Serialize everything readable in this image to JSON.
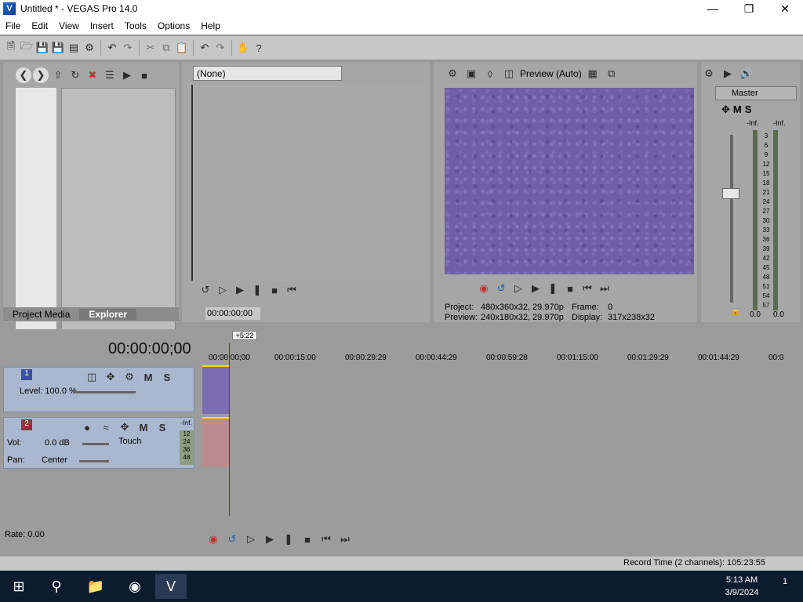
{
  "window": {
    "title": "Untitled * - VEGAS Pro 14.0"
  },
  "menu": [
    "File",
    "Edit",
    "View",
    "Insert",
    "Tools",
    "Options",
    "Help"
  ],
  "explorer": {
    "tabs": [
      "Project Media",
      "Explorer"
    ],
    "active_tab": "Explorer"
  },
  "trimmer": {
    "selected": "(None)",
    "timecode": "00:00:00;00"
  },
  "preview": {
    "quality": "Preview (Auto)",
    "project_label": "Project:",
    "project_value": "480x360x32, 29.970p",
    "preview_label": "Preview:",
    "preview_value": "240x180x32, 29.970p",
    "frame_label": "Frame:",
    "frame_value": "0",
    "display_label": "Display:",
    "display_value": "317x238x32"
  },
  "mixer": {
    "title": "Master",
    "inf_left": "-Inf.",
    "inf_right": "-Inf.",
    "scale": [
      "3",
      "6",
      "9",
      "12",
      "15",
      "18",
      "21",
      "24",
      "27",
      "30",
      "33",
      "36",
      "39",
      "42",
      "45",
      "48",
      "51",
      "54",
      "57"
    ],
    "foot_left": "0.0",
    "foot_right": "0.0"
  },
  "timeline": {
    "timecode": "00:00:00;00",
    "marker": "+5:22",
    "ruler": [
      "00:00:00;00",
      "00:00:15:00",
      "00:00:29:29",
      "00:00:44:29",
      "00:00:59:28",
      "00:01:15:00",
      "00:01:29:29",
      "00:01:44:29",
      "00:0"
    ],
    "video_track": {
      "number": "1",
      "level_label": "Level: 100.0 %"
    },
    "audio_track": {
      "number": "2",
      "vol_label": "Vol:",
      "vol_value": "0.0 dB",
      "pan_label": "Pan:",
      "pan_value": "Center",
      "automation": "Touch",
      "inf": "-Inf.",
      "meter_scale": [
        "12",
        "24",
        "36",
        "48"
      ]
    },
    "rate": "Rate: 0.00",
    "record_time": "Record Time (2 channels): 105:23:55"
  },
  "taskbar": {
    "time": "5:13 AM",
    "date": "3/9/2024",
    "notification_count": "1"
  }
}
